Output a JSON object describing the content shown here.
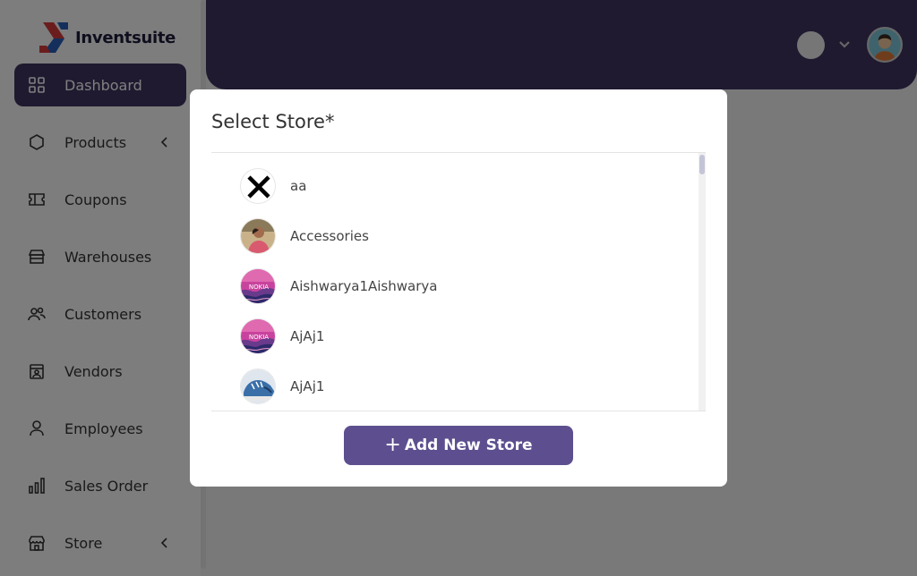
{
  "brand": {
    "name": "Inventsuite"
  },
  "sidebar": {
    "items": [
      {
        "label": "Dashboard",
        "icon": "dashboard-grid-icon",
        "active": true
      },
      {
        "label": "Products",
        "icon": "hexagon-icon",
        "has_submenu": true
      },
      {
        "label": "Coupons",
        "icon": "ticket-icon"
      },
      {
        "label": "Warehouses",
        "icon": "warehouse-icon"
      },
      {
        "label": "Customers",
        "icon": "users-icon"
      },
      {
        "label": "Vendors",
        "icon": "vendor-icon"
      },
      {
        "label": "Employees",
        "icon": "user-icon"
      },
      {
        "label": "Sales Order",
        "icon": "bar-chart-icon"
      },
      {
        "label": "Store",
        "icon": "store-icon",
        "has_submenu": true
      }
    ]
  },
  "modal": {
    "title": "Select Store*",
    "stores": [
      {
        "name": "aa",
        "avatar": "x-mark-avatar"
      },
      {
        "name": "Accessories",
        "avatar": "photo-person-avatar"
      },
      {
        "name": "Aishwarya1Aishwarya",
        "avatar": "nokia-logo-avatar"
      },
      {
        "name": "AjAj1",
        "avatar": "nokia-logo-avatar"
      },
      {
        "name": "AjAj1",
        "avatar": "shoe-avatar"
      }
    ],
    "add_button": {
      "plus": "+",
      "label": "Add New Store"
    }
  },
  "colors": {
    "primary": "#3f3560",
    "button": "#5d4f8f",
    "overlay": "rgba(0,0,0,0.5)"
  }
}
